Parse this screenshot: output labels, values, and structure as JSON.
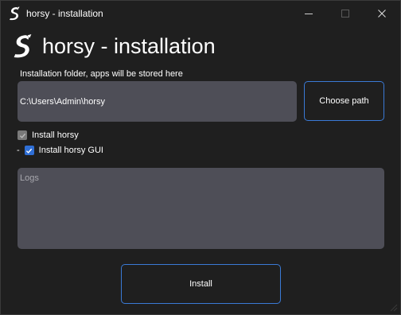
{
  "window": {
    "title": "horsy - installation",
    "app_icon": "horsy-logo-icon",
    "controls": [
      "minimize-icon",
      "maximize-icon",
      "close-icon"
    ]
  },
  "header": {
    "title": "horsy - installation",
    "logo": "horsy-logo-icon"
  },
  "folder": {
    "label": "Installation folder, apps will be stored here",
    "value": "C:\\Users\\Admin\\horsy",
    "choose_label": "Choose path"
  },
  "options": {
    "install_horsy": {
      "label": "Install horsy",
      "checked": true,
      "disabled": true
    },
    "install_gui": {
      "prefix": "-",
      "label": "Install horsy GUI",
      "checked": true,
      "disabled": false
    }
  },
  "logs": {
    "placeholder": "Logs"
  },
  "actions": {
    "install_label": "Install"
  },
  "colors": {
    "background": "#1f1f1f",
    "field": "#4e4e57",
    "accent": "#3a7ad6",
    "checkbox_checked": "#2f6fd6"
  }
}
